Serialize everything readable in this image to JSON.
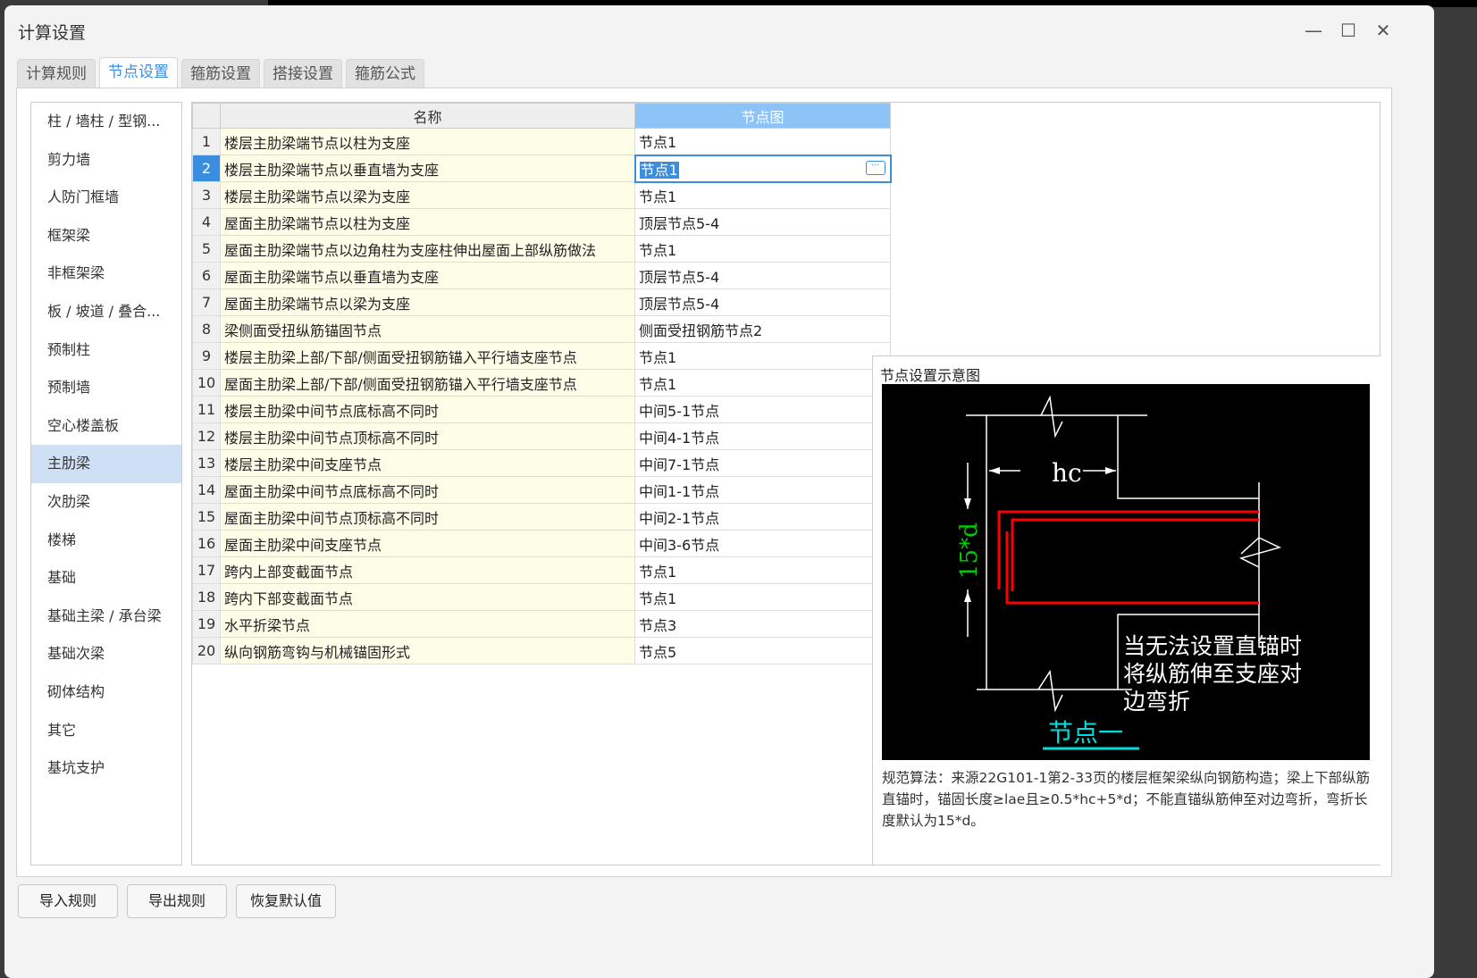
{
  "window": {
    "title": "计算设置",
    "minimize": "—",
    "maximize": "☐",
    "close": "✕"
  },
  "tabs": [
    "计算规则",
    "节点设置",
    "箍筋设置",
    "搭接设置",
    "箍筋公式"
  ],
  "sidebar": [
    "柱 / 墙柱 / 型钢...",
    "剪力墙",
    "人防门框墙",
    "框架梁",
    "非框架梁",
    "板 / 坡道 / 叠合...",
    "预制柱",
    "预制墙",
    "空心楼盖板",
    "主肋梁",
    "次肋梁",
    "楼梯",
    "基础",
    "基础主梁 / 承台梁",
    "基础次梁",
    "砌体结构",
    "其它",
    "基坑支护"
  ],
  "table": {
    "headers": [
      "",
      "名称",
      "节点图"
    ],
    "rows": [
      [
        "1",
        "楼层主肋梁端节点以柱为支座",
        "节点1"
      ],
      [
        "2",
        "楼层主肋梁端节点以垂直墙为支座",
        "节点1"
      ],
      [
        "3",
        "楼层主肋梁端节点以梁为支座",
        "节点1"
      ],
      [
        "4",
        "屋面主肋梁端节点以柱为支座",
        "顶层节点5-4"
      ],
      [
        "5",
        "屋面主肋梁端节点以边角柱为支座柱伸出屋面上部纵筋做法",
        "节点1"
      ],
      [
        "6",
        "屋面主肋梁端节点以垂直墙为支座",
        "顶层节点5-4"
      ],
      [
        "7",
        "屋面主肋梁端节点以梁为支座",
        "顶层节点5-4"
      ],
      [
        "8",
        "梁侧面受扭纵筋锚固节点",
        "侧面受扭钢筋节点2"
      ],
      [
        "9",
        "楼层主肋梁上部/下部/侧面受扭钢筋锚入平行墙支座节点",
        "节点1"
      ],
      [
        "10",
        "屋面主肋梁上部/下部/侧面受扭钢筋锚入平行墙支座节点",
        "节点1"
      ],
      [
        "11",
        "楼层主肋梁中间节点底标高不同时",
        "中间5-1节点"
      ],
      [
        "12",
        "楼层主肋梁中间节点顶标高不同时",
        "中间4-1节点"
      ],
      [
        "13",
        "楼层主肋梁中间支座节点",
        "中间7-1节点"
      ],
      [
        "14",
        "屋面主肋梁中间节点底标高不同时",
        "中间1-1节点"
      ],
      [
        "15",
        "屋面主肋梁中间节点顶标高不同时",
        "中间2-1节点"
      ],
      [
        "16",
        "屋面主肋梁中间支座节点",
        "中间3-6节点"
      ],
      [
        "17",
        "跨内上部变截面节点",
        "节点1"
      ],
      [
        "18",
        "跨内下部变截面节点",
        "节点1"
      ],
      [
        "19",
        "水平折梁节点",
        "节点3"
      ],
      [
        "20",
        "纵向钢筋弯钩与机械锚固形式",
        "节点5"
      ]
    ],
    "ellipsis": "···"
  },
  "diagram": {
    "title": "节点设置示意图",
    "dim_hc": "hc",
    "dim_15d": "15*d",
    "note": [
      "当无法设置直锚时",
      "将纵筋伸至支座对",
      "边弯折"
    ],
    "caption": "节点一",
    "description": "规范算法：来源22G101-1第2-33页的楼层框架梁纵向钢筋构造；梁上下部纵筋直锚时，锚固长度≥lae且≥0.5*hc+5*d；不能直锚纵筋伸至对边弯折，弯折长度默认为15*d。"
  },
  "buttons": [
    "导入规则",
    "导出规则",
    "恢复默认值"
  ]
}
